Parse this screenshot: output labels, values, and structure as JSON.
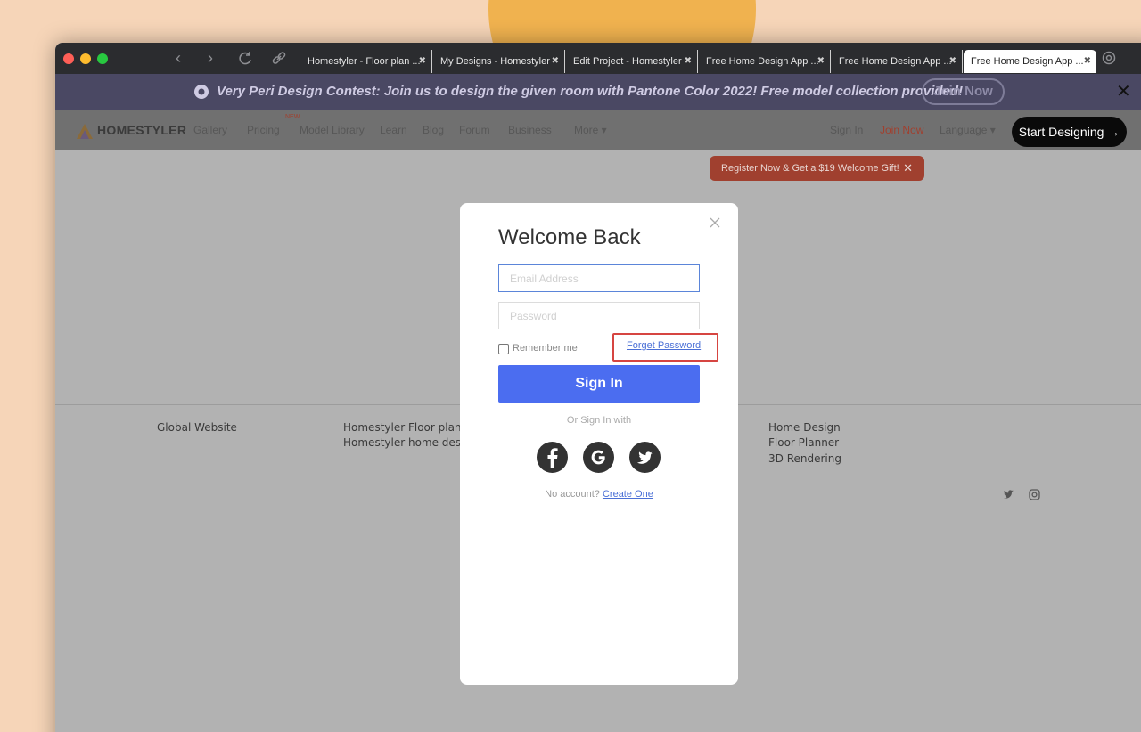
{
  "browser": {
    "tabs": [
      {
        "title": "Homestyler - Floor plan ...",
        "active": false
      },
      {
        "title": "My Designs - Homestyler",
        "active": false
      },
      {
        "title": "Edit Project - Homestyler",
        "active": false
      },
      {
        "title": "Free Home Design App ...",
        "active": false
      },
      {
        "title": "Free Home Design App ...",
        "active": false
      },
      {
        "title": "Free Home Design App ...",
        "active": true
      }
    ],
    "back_icon": "‹",
    "forward_icon": "›",
    "reload_icon": "↻",
    "link_icon": "🔗",
    "tab_close_icon": "✖"
  },
  "promo": {
    "text": "Very Peri Design Contest: Join us to design the given room with Pantone Color 2022! Free model collection provided!",
    "join_label": "Join Now",
    "close_icon": "✕"
  },
  "site_nav": {
    "logo": "HOMESTYLER",
    "links": [
      "Gallery",
      "Pricing",
      "Model Library",
      "Learn",
      "Blog",
      "Forum",
      "Business",
      "More ▾"
    ],
    "new_tag": "NEW",
    "sign_in": "Sign In",
    "join_now": "Join Now",
    "language": "Language ▾",
    "start_designing": "Start Designing →"
  },
  "gift_banner": {
    "text": "Register Now & Get a $19 Welcome Gift!",
    "close_icon": "✕"
  },
  "footer": {
    "col1": [
      "Global Website"
    ],
    "col2": [
      "Homestyler Floor planr",
      "Homestyler home desig"
    ],
    "col3": [
      "Home Design",
      "Floor Planner",
      "3D Rendering"
    ]
  },
  "login_modal": {
    "title": "Welcome Back",
    "email_placeholder": "Email Address",
    "password_placeholder": "Password",
    "remember_label": "Remember me",
    "forgot_label": "Forget Password",
    "sign_in_label": "Sign In",
    "or_text": "Or Sign In with",
    "no_account_text": "No account?",
    "create_label": "Create One"
  },
  "colors": {
    "primary_button": "#4b6df0",
    "highlight_box": "#d64541",
    "gift_banner": "#a0402f",
    "promo_banner": "#4a4863"
  }
}
